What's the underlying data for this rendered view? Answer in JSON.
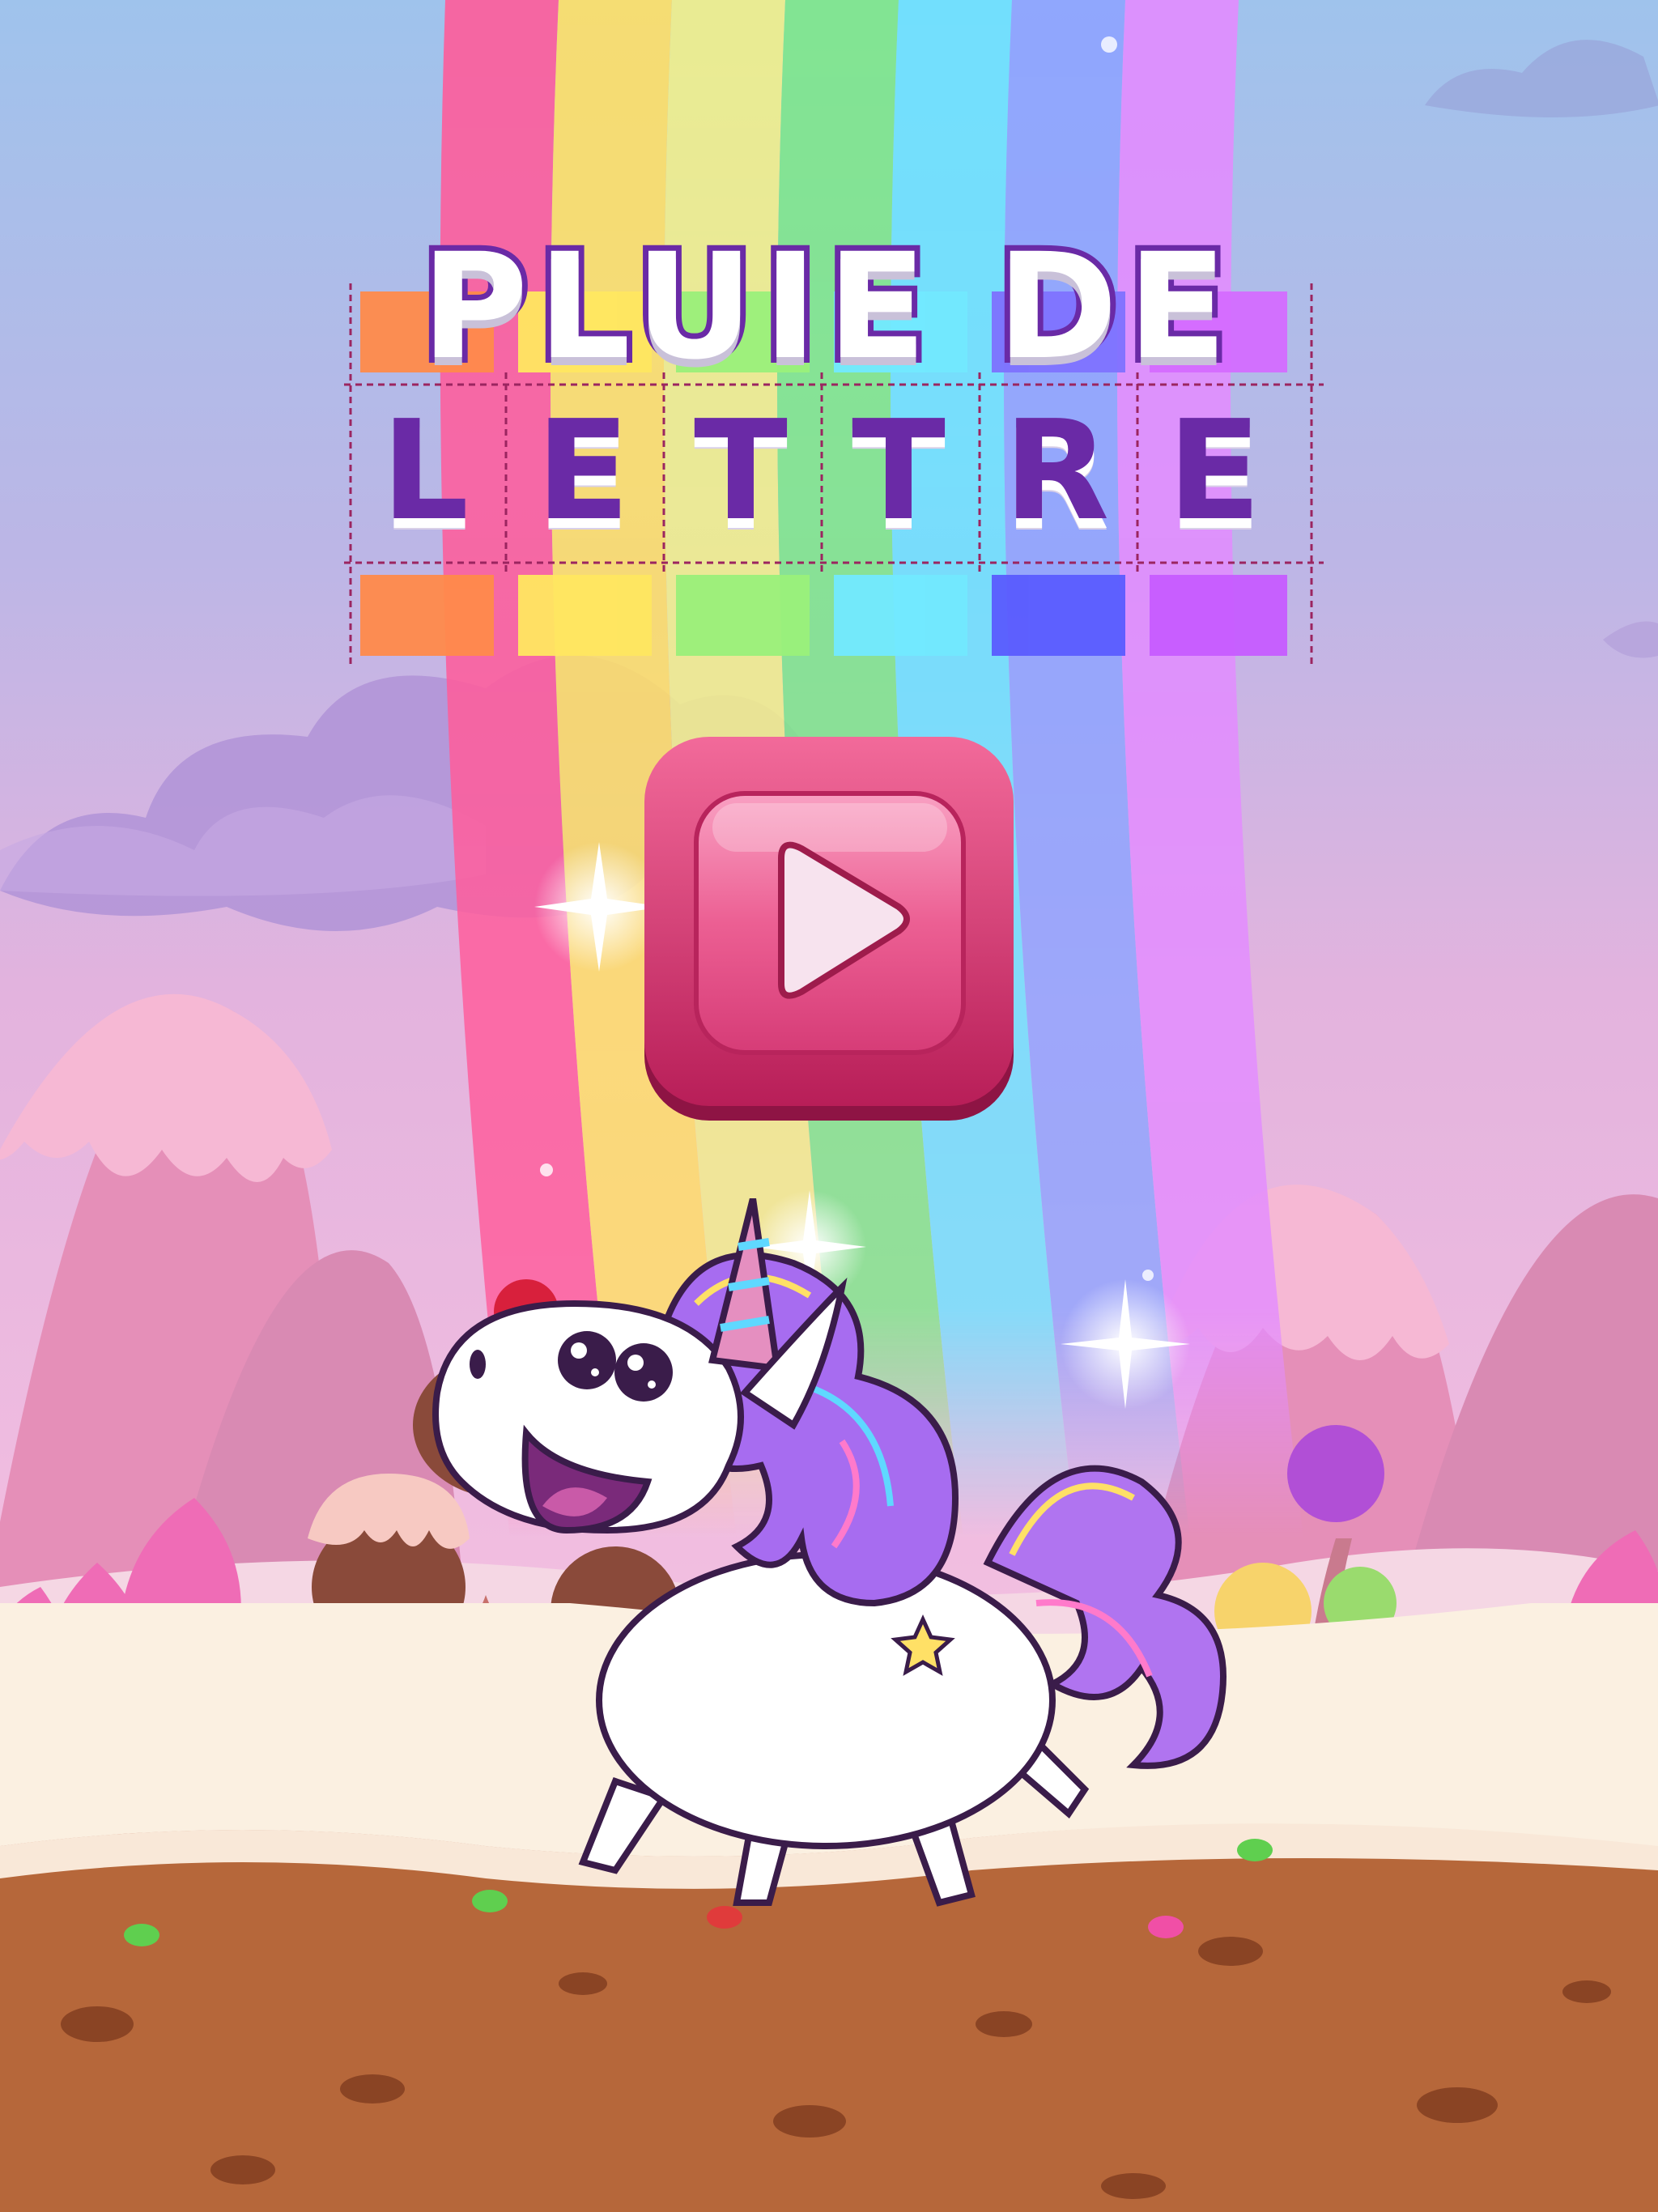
{
  "title": {
    "line1": "PLUIE DE",
    "letters": [
      "L",
      "E",
      "T",
      "T",
      "R",
      "E"
    ]
  },
  "play_button": {
    "icon": "play-icon",
    "color": "#e0457c"
  },
  "colors": {
    "title_text": "#6a2aa6",
    "title_fill": "#ffffff",
    "rainbow": [
      "#ff7a3d",
      "#ffd84a",
      "#7fe07a",
      "#5fd8ff",
      "#7a6cff",
      "#c65cff"
    ]
  },
  "characters": {
    "mascot": "unicorn"
  }
}
